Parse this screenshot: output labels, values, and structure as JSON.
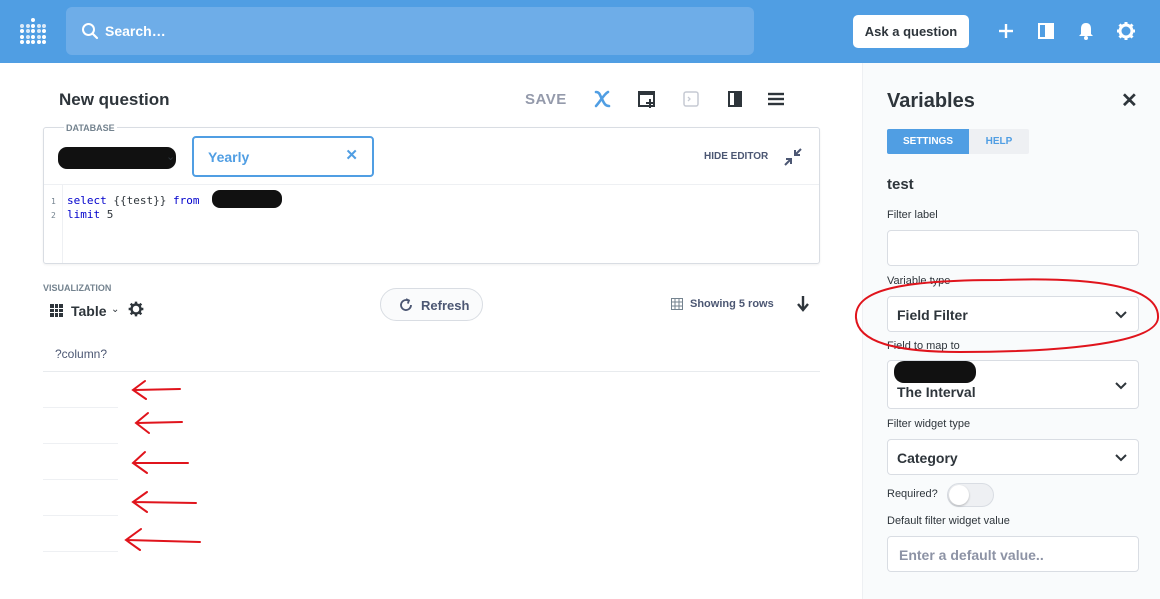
{
  "topnav": {
    "search_placeholder": "Search…",
    "ask_button": "Ask a question",
    "icons": [
      "metabase-logo-icon",
      "search-icon",
      "plus-icon",
      "collection-icon",
      "bell-icon",
      "gear-icon"
    ]
  },
  "question": {
    "title": "New question",
    "save_label": "SAVE",
    "header_icons": [
      "variables-x-icon",
      "add-snippet-icon",
      "terminal-icon",
      "data-reference-icon",
      "menu-icon"
    ]
  },
  "editor": {
    "database_label": "DATABASE",
    "variable_widget_value": "Yearly",
    "variable_widget_clear": "✕",
    "hide_editor_label": "HIDE EDITOR",
    "code_lines": [
      {
        "num": "1",
        "keyword1": "select",
        "middle": " {{test}} ",
        "keyword2": "from",
        "tail": ""
      },
      {
        "num": "2",
        "keyword1": "limit",
        "middle": " 5",
        "keyword2": "",
        "tail": ""
      }
    ]
  },
  "visualization": {
    "label": "VISUALIZATION",
    "selected": "Table",
    "refresh_label": "Refresh",
    "row_count_text": "Showing 5 rows",
    "column_header": "?column?"
  },
  "variables_panel": {
    "title": "Variables",
    "close_glyph": "✕",
    "tabs": {
      "settings": "SETTINGS",
      "help": "HELP"
    },
    "variable_name": "test",
    "filter_label": {
      "label": "Filter label",
      "value": ""
    },
    "variable_type": {
      "label": "Variable type",
      "value": "Field Filter"
    },
    "field_to_map_to": {
      "label": "Field to map to",
      "value": "The Interval"
    },
    "filter_widget_type": {
      "label": "Filter widget type",
      "value": "Category"
    },
    "required": {
      "label": "Required?",
      "on": false
    },
    "default_value": {
      "label": "Default filter widget value",
      "placeholder": "Enter a default value.."
    }
  },
  "colors": {
    "brand": "#509ee3",
    "text_dark": "#2e353b",
    "annotation_red": "#e0141c"
  }
}
